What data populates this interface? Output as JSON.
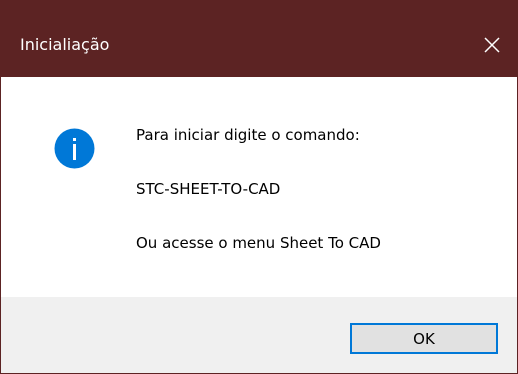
{
  "window": {
    "title": "Inicialiação"
  },
  "icons": {
    "info": "info-icon",
    "close": "close-icon"
  },
  "message": {
    "line1": "Para iniciar digite o comando:",
    "line2": "STC-SHEET-TO-CAD",
    "line3": "Ou acesse o menu Sheet To CAD"
  },
  "buttons": {
    "ok_label": "OK"
  },
  "colors": {
    "titlebar": "#5c2323",
    "accent": "#0078d7",
    "footer": "#f0f0f0"
  }
}
